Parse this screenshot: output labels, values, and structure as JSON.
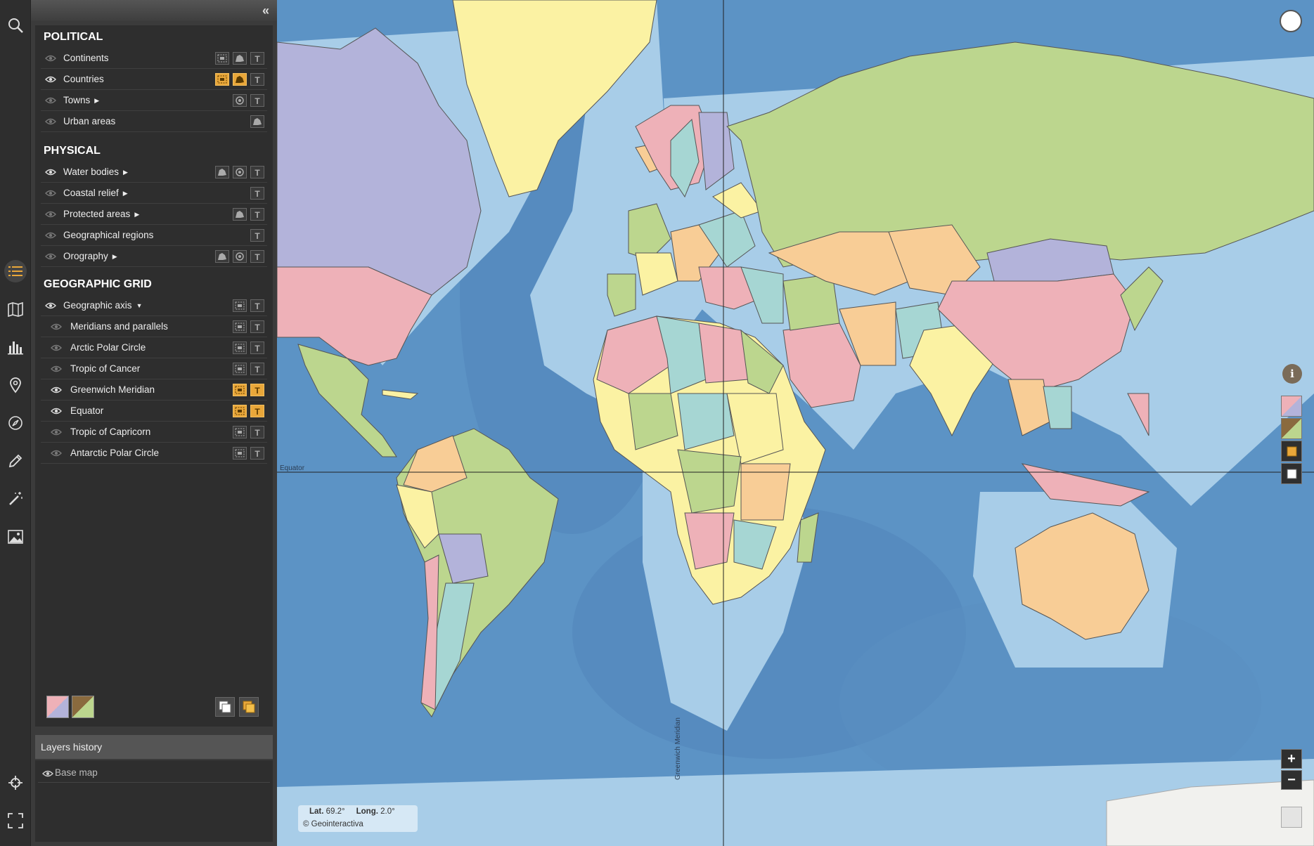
{
  "panel": {
    "collapse_icon": "double-chevron-left-icon",
    "sections": [
      {
        "title": "POLITICAL",
        "rows": [
          {
            "label": "Continents",
            "visible": false,
            "expand": false,
            "buttons": [
              {
                "icon": "fill-icon",
                "on": false
              },
              {
                "icon": "outline-icon",
                "on": false
              },
              {
                "icon": "text-icon",
                "on": false
              }
            ]
          },
          {
            "label": "Countries",
            "visible": true,
            "expand": false,
            "buttons": [
              {
                "icon": "fill-icon",
                "on": true
              },
              {
                "icon": "outline-icon",
                "on": true
              },
              {
                "icon": "text-icon",
                "on": false
              }
            ]
          },
          {
            "label": "Towns",
            "visible": false,
            "expand": true,
            "buttons": [
              {
                "icon": "point-icon",
                "on": false
              },
              {
                "icon": "text-icon",
                "on": false
              }
            ]
          },
          {
            "label": "Urban areas",
            "visible": false,
            "expand": false,
            "buttons": [
              {
                "icon": "outline-icon",
                "on": false
              }
            ]
          }
        ]
      },
      {
        "title": "PHYSICAL",
        "rows": [
          {
            "label": "Water bodies",
            "visible": true,
            "expand": true,
            "buttons": [
              {
                "icon": "outline-icon",
                "on": false
              },
              {
                "icon": "point-icon",
                "on": false
              },
              {
                "icon": "text-icon",
                "on": false
              }
            ]
          },
          {
            "label": "Coastal relief",
            "visible": false,
            "expand": true,
            "buttons": [
              {
                "icon": "text-icon",
                "on": false
              }
            ]
          },
          {
            "label": "Protected areas",
            "visible": false,
            "expand": true,
            "buttons": [
              {
                "icon": "outline-icon",
                "on": false
              },
              {
                "icon": "text-icon",
                "on": false
              }
            ]
          },
          {
            "label": "Geographical regions",
            "visible": false,
            "expand": false,
            "buttons": [
              {
                "icon": "text-icon",
                "on": false
              }
            ]
          },
          {
            "label": "Orography",
            "visible": false,
            "expand": true,
            "buttons": [
              {
                "icon": "outline-icon",
                "on": false
              },
              {
                "icon": "point-icon",
                "on": false
              },
              {
                "icon": "text-icon",
                "on": false
              }
            ]
          }
        ]
      },
      {
        "title": "GEOGRAPHIC GRID",
        "rows": [
          {
            "label": "Geographic axis",
            "visible": true,
            "expand": "down",
            "buttons": [
              {
                "icon": "fill-icon",
                "on": false
              },
              {
                "icon": "text-icon",
                "on": false
              }
            ]
          },
          {
            "label": "Meridians and parallels",
            "sub": true,
            "visible": false,
            "buttons": [
              {
                "icon": "fill-icon",
                "on": false
              },
              {
                "icon": "text-icon",
                "on": false
              }
            ]
          },
          {
            "label": "Arctic Polar Circle",
            "sub": true,
            "visible": false,
            "buttons": [
              {
                "icon": "fill-icon",
                "on": false
              },
              {
                "icon": "text-icon",
                "on": false
              }
            ]
          },
          {
            "label": "Tropic of Cancer",
            "sub": true,
            "visible": false,
            "buttons": [
              {
                "icon": "fill-icon",
                "on": false
              },
              {
                "icon": "text-icon",
                "on": false
              }
            ]
          },
          {
            "label": "Greenwich Meridian",
            "sub": true,
            "visible": true,
            "buttons": [
              {
                "icon": "fill-icon",
                "on": true
              },
              {
                "icon": "text-icon",
                "on": true
              }
            ]
          },
          {
            "label": "Equator",
            "sub": true,
            "visible": true,
            "buttons": [
              {
                "icon": "fill-icon",
                "on": true
              },
              {
                "icon": "text-icon",
                "on": true
              }
            ]
          },
          {
            "label": "Tropic of Capricorn",
            "sub": true,
            "visible": false,
            "buttons": [
              {
                "icon": "fill-icon",
                "on": false
              },
              {
                "icon": "text-icon",
                "on": false
              }
            ]
          },
          {
            "label": "Antarctic Polar Circle",
            "sub": true,
            "visible": false,
            "buttons": [
              {
                "icon": "fill-icon",
                "on": false
              },
              {
                "icon": "text-icon",
                "on": false
              }
            ]
          }
        ]
      }
    ],
    "history_title": "Layers history",
    "history_items": [
      "Base map"
    ]
  },
  "toolbar": [
    "search-icon",
    "layers-list-icon",
    "map-book-icon",
    "bar-chart-icon",
    "location-pin-icon",
    "compass-icon",
    "pencil-icon",
    "magic-wand-icon",
    "image-icon",
    "crosshair-icon",
    "fullscreen-icon"
  ],
  "map": {
    "equator_label": "Equator",
    "greenwich_label": "Greenwich Meridian",
    "coords": {
      "lat_label": "Lat.",
      "lat_value": "69.2°",
      "long_label": "Long.",
      "long_value": "2.0°",
      "copyright": "© Geointeractiva"
    },
    "zoom_in": "+",
    "zoom_out": "−",
    "info": "i"
  },
  "colors": {
    "ocean": "#5c93c5",
    "shelf": "#a8cde8",
    "pink": "#eeb1b8",
    "green": "#bcd68e",
    "yellow": "#fbf2a3",
    "orange": "#f8cd96",
    "purple": "#b3b3da",
    "teal": "#a6d6d3",
    "accent": "#e9a73a"
  }
}
